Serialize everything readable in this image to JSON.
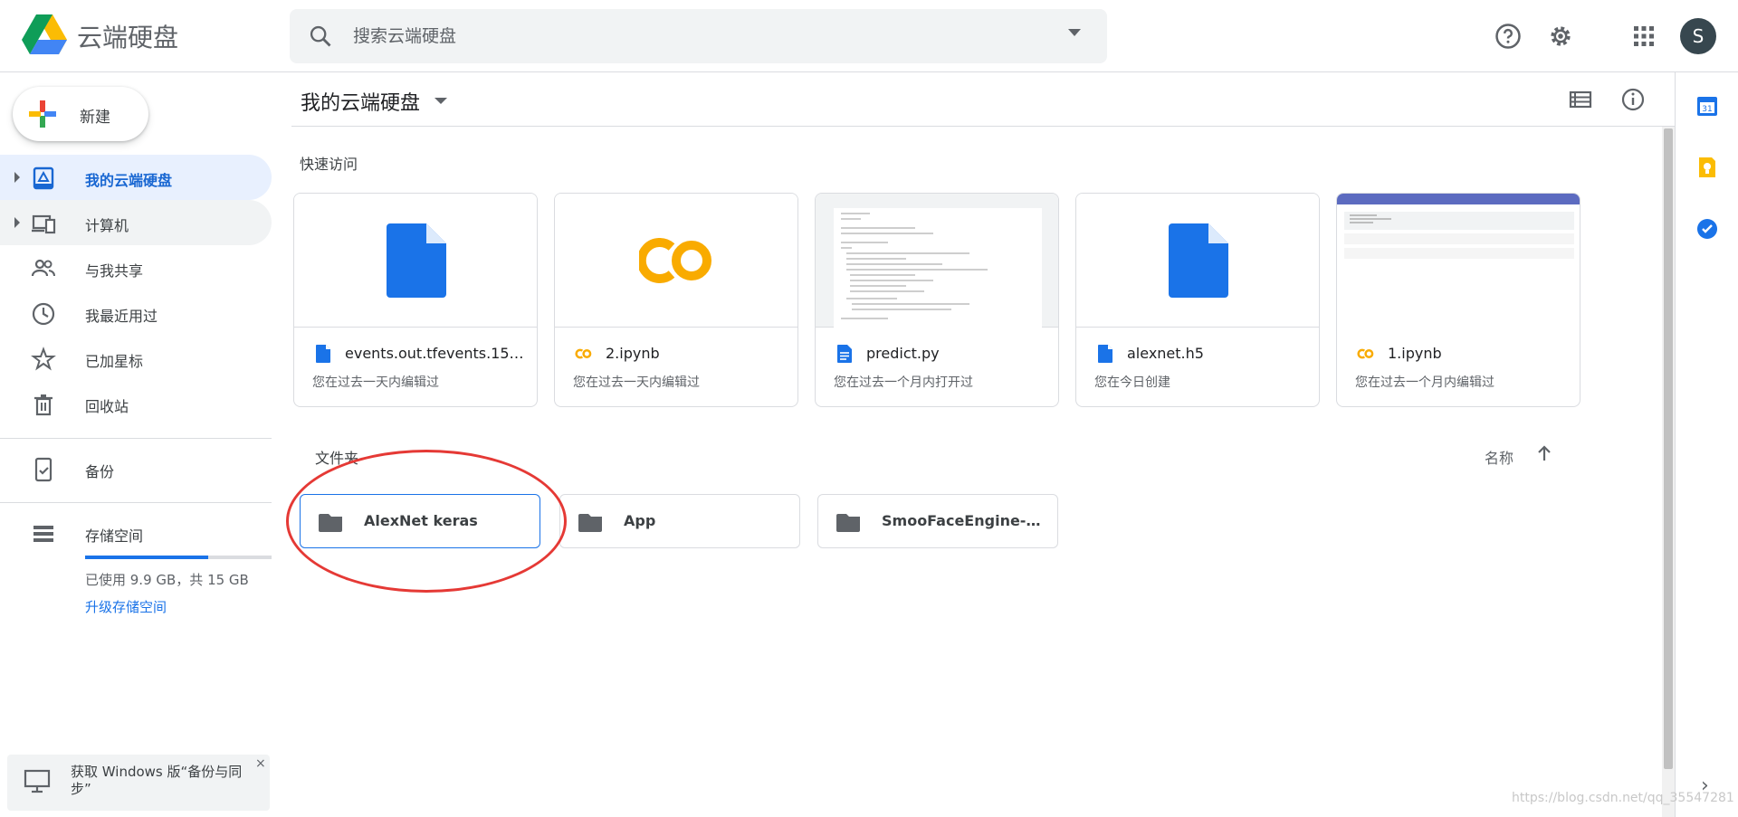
{
  "header": {
    "app_title": "云端硬盘",
    "search_placeholder": "搜索云端硬盘",
    "avatar_letter": "S"
  },
  "sidebar": {
    "new_label": "新建",
    "items": [
      {
        "label": "我的云端硬盘",
        "icon": "my-drive-icon"
      },
      {
        "label": "计算机",
        "icon": "computers-icon"
      },
      {
        "label": "与我共享",
        "icon": "shared-icon"
      },
      {
        "label": "我最近用过",
        "icon": "recent-icon"
      },
      {
        "label": "已加星标",
        "icon": "star-icon"
      },
      {
        "label": "回收站",
        "icon": "trash-icon"
      },
      {
        "label": "备份",
        "icon": "backup-icon"
      },
      {
        "label": "存储空间",
        "icon": "storage-icon"
      }
    ],
    "storage_used_fraction": 0.66,
    "storage_text": "已使用 9.9 GB，共 15 GB",
    "upgrade_label": "升级存储空间",
    "promo_text": "获取 Windows 版“备份与同步”",
    "promo_close": "×"
  },
  "main": {
    "breadcrumb": "我的云端硬盘",
    "quick_access_title": "快速访问",
    "quick_access": [
      {
        "name": "events.out.tfevents.1563...",
        "subtitle": "您在过去一天内编辑过",
        "type": "file"
      },
      {
        "name": "2.ipynb",
        "subtitle": "您在过去一天内编辑过",
        "type": "colab"
      },
      {
        "name": "predict.py",
        "subtitle": "您在过去一个月内打开过",
        "type": "doc"
      },
      {
        "name": "alexnet.h5",
        "subtitle": "您在今日创建",
        "type": "file"
      },
      {
        "name": "1.ipynb",
        "subtitle": "您在过去一个月内编辑过",
        "type": "colab"
      }
    ],
    "folders_title": "文件夹",
    "sort_label": "名称",
    "folders": [
      {
        "name": "AlexNet keras"
      },
      {
        "name": "App"
      },
      {
        "name": "SmooFaceEngine-mast..."
      }
    ]
  },
  "watermark": "https://blog.csdn.net/qq_35547281",
  "colors": {
    "accent": "#1a73e8",
    "active_bg": "#e8f0fe",
    "annotation": "#e53935",
    "colab_orange": "#f9ab00"
  }
}
